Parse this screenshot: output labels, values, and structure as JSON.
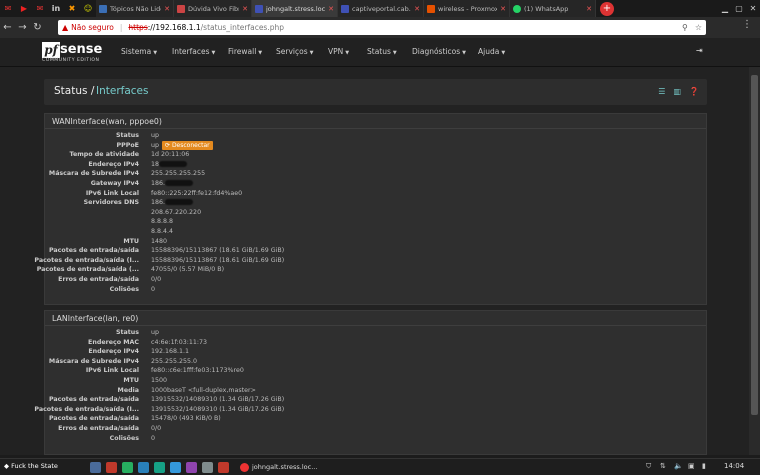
{
  "browser": {
    "tabs": [
      {
        "title": "Tópicos Não Lidos",
        "color": "#3b6fb6"
      },
      {
        "title": "Dúvida Vivo Fibra",
        "color": "#c44"
      },
      {
        "title": "johngalt.stress.loc",
        "color": "#3f51b5",
        "active": true
      },
      {
        "title": "captiveportal.cab.",
        "color": "#3f51b5"
      },
      {
        "title": "wireless - Proxmox",
        "color": "#e65100"
      },
      {
        "title": "(1) WhatsApp",
        "color": "#25d366"
      }
    ],
    "pinned_icons": [
      "gmail-icon",
      "youtube-icon",
      "mail-icon",
      "linkedin-icon",
      "chat-icon"
    ],
    "url": {
      "security_label": "Não seguro",
      "scheme": "https",
      "host": "://192.168.1.1",
      "path": "/status_interfaces.php"
    }
  },
  "pfsense": {
    "logo_pf": "pf",
    "logo_sense": "sense",
    "logo_edition": "COMMUNITY EDITION",
    "menu": [
      "Sistema",
      "Interfaces",
      "Firewall",
      "Serviços",
      "VPN",
      "Status",
      "Diagnósticos",
      "Ajuda"
    ]
  },
  "breadcrumb": {
    "section": "Status",
    "sep": "/",
    "page": "Interfaces"
  },
  "wan": {
    "title": "WANInterface(wan, pppoe0)",
    "disconnect_label": "Desconectar",
    "rows": [
      {
        "label": "Status",
        "value": "up"
      },
      {
        "label": "PPPoE",
        "value": "up"
      },
      {
        "label": "Tempo de atividade",
        "value": "1d 20:11:06"
      },
      {
        "label": "Endereço IPv4",
        "value": "18"
      },
      {
        "label": "Máscara de Subrede IPv4",
        "value": "255.255.255.255"
      },
      {
        "label": "Gateway IPv4",
        "value": "186."
      },
      {
        "label": "IPv6 Link Local",
        "value": "fe80::225:22ff:fe12:fd4%ae0"
      },
      {
        "label": "Servidores DNS",
        "value": "186."
      },
      {
        "label": "",
        "value": "208.67.220.220"
      },
      {
        "label": "",
        "value": "8.8.8.8"
      },
      {
        "label": "",
        "value": "8.8.4.4"
      },
      {
        "label": "MTU",
        "value": "1480"
      },
      {
        "label": "Pacotes de entrada/saída",
        "value": "15588396/15113867 (18.61 GiB/1.69 GiB)"
      },
      {
        "label": "Pacotes de entrada/saída (I...",
        "value": "15588396/15113867 (18.61 GiB/1.69 GiB)"
      },
      {
        "label": "Pacotes de entrada/saída (...",
        "value": "47055/0 (5.57 MiB/0 B)"
      },
      {
        "label": "Erros de entrada/saída",
        "value": "0/0"
      },
      {
        "label": "Colisões",
        "value": "0"
      }
    ]
  },
  "lan": {
    "title": "LANInterface(lan, re0)",
    "rows": [
      {
        "label": "Status",
        "value": "up"
      },
      {
        "label": "Endereço MAC",
        "value": "c4:6e:1f:03:11:73"
      },
      {
        "label": "Endereço IPv4",
        "value": "192.168.1.1"
      },
      {
        "label": "Máscara de Subrede IPv4",
        "value": "255.255.255.0"
      },
      {
        "label": "IPv6 Link Local",
        "value": "fe80::c6e:1fff:fe03:1173%re0"
      },
      {
        "label": "MTU",
        "value": "1500"
      },
      {
        "label": "Media",
        "value": "1000baseT <full-duplex,master>"
      },
      {
        "label": "Pacotes de entrada/saída",
        "value": "13915532/14089310 (1.34 GiB/17.26 GiB)"
      },
      {
        "label": "Pacotes de entrada/saída (I...",
        "value": "13915532/14089310 (1.34 GiB/17.26 GiB)"
      },
      {
        "label": "Pacotes de entrada/saída",
        "value": "15478/0 (493 KiB/0 B)"
      },
      {
        "label": "Erros de entrada/saída",
        "value": "0/0"
      },
      {
        "label": "Colisões",
        "value": "0"
      }
    ]
  },
  "taskbar": {
    "start_label": "Fuck the State",
    "window_label": "johngalt.stress.loc...",
    "clock": "14:04"
  }
}
